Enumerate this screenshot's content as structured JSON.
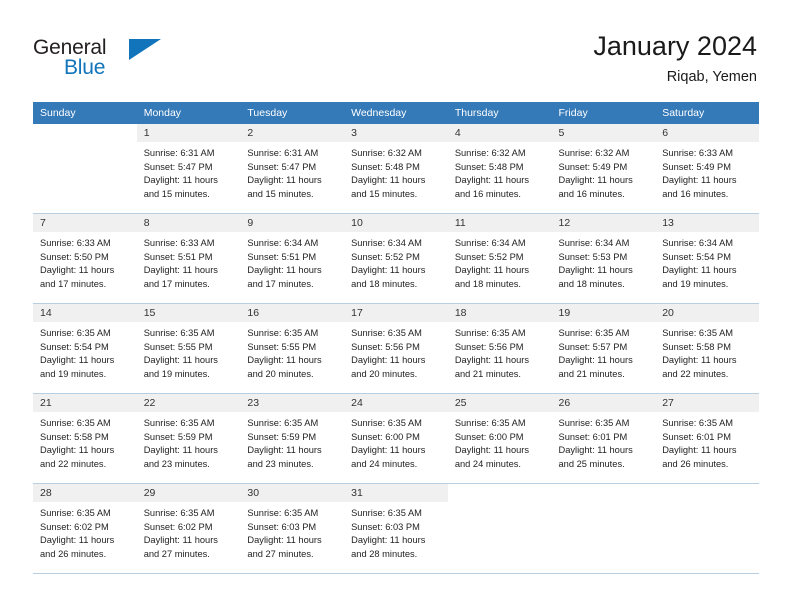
{
  "brand": {
    "name_part1": "General",
    "name_part2": "Blue",
    "logo_icon": "triangle-flag-icon",
    "accent_color": "#1275bc"
  },
  "header": {
    "title": "January 2024",
    "subtitle": "Riqab, Yemen"
  },
  "calendar": {
    "header_background": "#3479b8",
    "daynum_background": "#f0f0f0",
    "grid_line_color": "#b8cfe2",
    "columns": [
      "Sunday",
      "Monday",
      "Tuesday",
      "Wednesday",
      "Thursday",
      "Friday",
      "Saturday"
    ],
    "weeks": [
      [
        {
          "day": "",
          "lines": [],
          "blank": true
        },
        {
          "day": "1",
          "lines": [
            "Sunrise: 6:31 AM",
            "Sunset: 5:47 PM",
            "Daylight: 11 hours",
            "and 15 minutes."
          ]
        },
        {
          "day": "2",
          "lines": [
            "Sunrise: 6:31 AM",
            "Sunset: 5:47 PM",
            "Daylight: 11 hours",
            "and 15 minutes."
          ]
        },
        {
          "day": "3",
          "lines": [
            "Sunrise: 6:32 AM",
            "Sunset: 5:48 PM",
            "Daylight: 11 hours",
            "and 15 minutes."
          ]
        },
        {
          "day": "4",
          "lines": [
            "Sunrise: 6:32 AM",
            "Sunset: 5:48 PM",
            "Daylight: 11 hours",
            "and 16 minutes."
          ]
        },
        {
          "day": "5",
          "lines": [
            "Sunrise: 6:32 AM",
            "Sunset: 5:49 PM",
            "Daylight: 11 hours",
            "and 16 minutes."
          ]
        },
        {
          "day": "6",
          "lines": [
            "Sunrise: 6:33 AM",
            "Sunset: 5:49 PM",
            "Daylight: 11 hours",
            "and 16 minutes."
          ]
        }
      ],
      [
        {
          "day": "7",
          "lines": [
            "Sunrise: 6:33 AM",
            "Sunset: 5:50 PM",
            "Daylight: 11 hours",
            "and 17 minutes."
          ]
        },
        {
          "day": "8",
          "lines": [
            "Sunrise: 6:33 AM",
            "Sunset: 5:51 PM",
            "Daylight: 11 hours",
            "and 17 minutes."
          ]
        },
        {
          "day": "9",
          "lines": [
            "Sunrise: 6:34 AM",
            "Sunset: 5:51 PM",
            "Daylight: 11 hours",
            "and 17 minutes."
          ]
        },
        {
          "day": "10",
          "lines": [
            "Sunrise: 6:34 AM",
            "Sunset: 5:52 PM",
            "Daylight: 11 hours",
            "and 18 minutes."
          ]
        },
        {
          "day": "11",
          "lines": [
            "Sunrise: 6:34 AM",
            "Sunset: 5:52 PM",
            "Daylight: 11 hours",
            "and 18 minutes."
          ]
        },
        {
          "day": "12",
          "lines": [
            "Sunrise: 6:34 AM",
            "Sunset: 5:53 PM",
            "Daylight: 11 hours",
            "and 18 minutes."
          ]
        },
        {
          "day": "13",
          "lines": [
            "Sunrise: 6:34 AM",
            "Sunset: 5:54 PM",
            "Daylight: 11 hours",
            "and 19 minutes."
          ]
        }
      ],
      [
        {
          "day": "14",
          "lines": [
            "Sunrise: 6:35 AM",
            "Sunset: 5:54 PM",
            "Daylight: 11 hours",
            "and 19 minutes."
          ]
        },
        {
          "day": "15",
          "lines": [
            "Sunrise: 6:35 AM",
            "Sunset: 5:55 PM",
            "Daylight: 11 hours",
            "and 19 minutes."
          ]
        },
        {
          "day": "16",
          "lines": [
            "Sunrise: 6:35 AM",
            "Sunset: 5:55 PM",
            "Daylight: 11 hours",
            "and 20 minutes."
          ]
        },
        {
          "day": "17",
          "lines": [
            "Sunrise: 6:35 AM",
            "Sunset: 5:56 PM",
            "Daylight: 11 hours",
            "and 20 minutes."
          ]
        },
        {
          "day": "18",
          "lines": [
            "Sunrise: 6:35 AM",
            "Sunset: 5:56 PM",
            "Daylight: 11 hours",
            "and 21 minutes."
          ]
        },
        {
          "day": "19",
          "lines": [
            "Sunrise: 6:35 AM",
            "Sunset: 5:57 PM",
            "Daylight: 11 hours",
            "and 21 minutes."
          ]
        },
        {
          "day": "20",
          "lines": [
            "Sunrise: 6:35 AM",
            "Sunset: 5:58 PM",
            "Daylight: 11 hours",
            "and 22 minutes."
          ]
        }
      ],
      [
        {
          "day": "21",
          "lines": [
            "Sunrise: 6:35 AM",
            "Sunset: 5:58 PM",
            "Daylight: 11 hours",
            "and 22 minutes."
          ]
        },
        {
          "day": "22",
          "lines": [
            "Sunrise: 6:35 AM",
            "Sunset: 5:59 PM",
            "Daylight: 11 hours",
            "and 23 minutes."
          ]
        },
        {
          "day": "23",
          "lines": [
            "Sunrise: 6:35 AM",
            "Sunset: 5:59 PM",
            "Daylight: 11 hours",
            "and 23 minutes."
          ]
        },
        {
          "day": "24",
          "lines": [
            "Sunrise: 6:35 AM",
            "Sunset: 6:00 PM",
            "Daylight: 11 hours",
            "and 24 minutes."
          ]
        },
        {
          "day": "25",
          "lines": [
            "Sunrise: 6:35 AM",
            "Sunset: 6:00 PM",
            "Daylight: 11 hours",
            "and 24 minutes."
          ]
        },
        {
          "day": "26",
          "lines": [
            "Sunrise: 6:35 AM",
            "Sunset: 6:01 PM",
            "Daylight: 11 hours",
            "and 25 minutes."
          ]
        },
        {
          "day": "27",
          "lines": [
            "Sunrise: 6:35 AM",
            "Sunset: 6:01 PM",
            "Daylight: 11 hours",
            "and 26 minutes."
          ]
        }
      ],
      [
        {
          "day": "28",
          "lines": [
            "Sunrise: 6:35 AM",
            "Sunset: 6:02 PM",
            "Daylight: 11 hours",
            "and 26 minutes."
          ]
        },
        {
          "day": "29",
          "lines": [
            "Sunrise: 6:35 AM",
            "Sunset: 6:02 PM",
            "Daylight: 11 hours",
            "and 27 minutes."
          ]
        },
        {
          "day": "30",
          "lines": [
            "Sunrise: 6:35 AM",
            "Sunset: 6:03 PM",
            "Daylight: 11 hours",
            "and 27 minutes."
          ]
        },
        {
          "day": "31",
          "lines": [
            "Sunrise: 6:35 AM",
            "Sunset: 6:03 PM",
            "Daylight: 11 hours",
            "and 28 minutes."
          ]
        },
        {
          "day": "",
          "lines": [],
          "blank": true
        },
        {
          "day": "",
          "lines": [],
          "blank": true
        },
        {
          "day": "",
          "lines": [],
          "blank": true
        }
      ]
    ]
  }
}
